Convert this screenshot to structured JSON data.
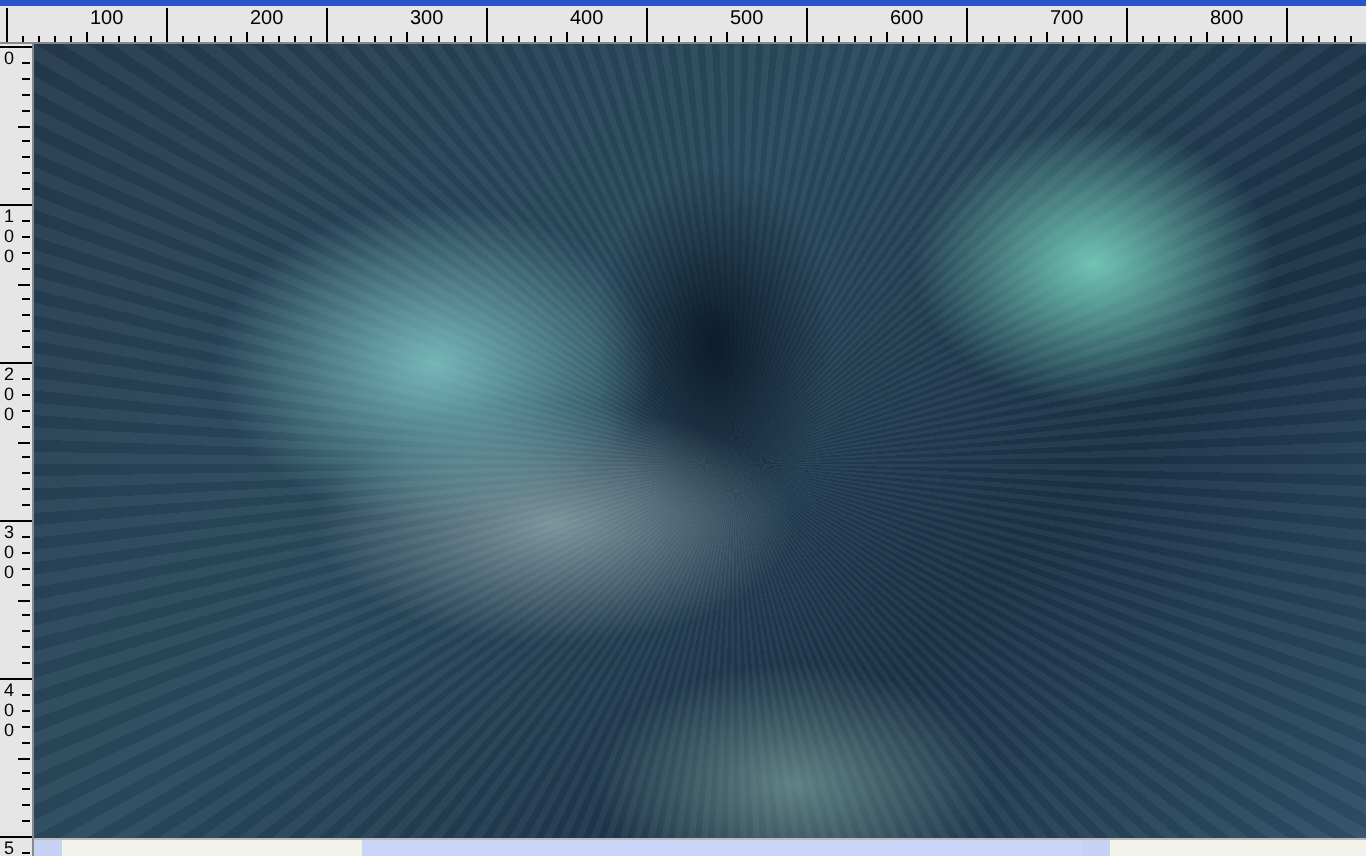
{
  "top_ruler": {
    "labels": [
      "100",
      "200",
      "300",
      "400",
      "500",
      "600",
      "700",
      "800"
    ]
  },
  "left_ruler": {
    "labels": [
      "0",
      "100",
      "200",
      "300",
      "400",
      "5"
    ]
  },
  "canvas": {
    "kind": "image"
  }
}
